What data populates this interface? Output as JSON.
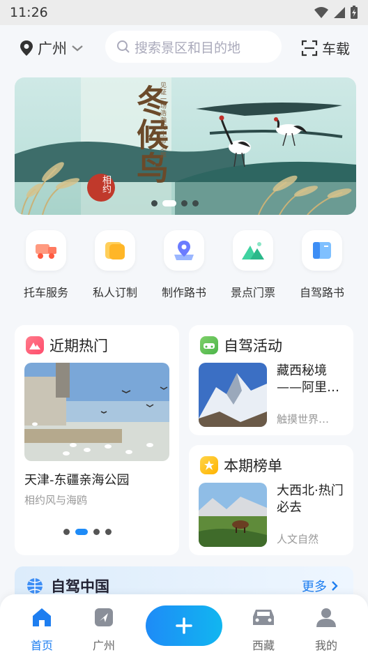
{
  "status_bar": {
    "time": "11:26"
  },
  "header": {
    "city": "广州",
    "search_placeholder": "搜索景区和目的地",
    "carload_label": "车载"
  },
  "banner": {
    "title": "冬候鸟",
    "subtitle_vertical": "见证一场浩瀚的生命之旅",
    "seal_text": "相约",
    "page_count": 4,
    "active_page": 1
  },
  "quick_nav": [
    {
      "label": "托车服务",
      "icon": "truck-icon"
    },
    {
      "label": "私人订制",
      "icon": "folder-icon"
    },
    {
      "label": "制作路书",
      "icon": "map-pin-icon"
    },
    {
      "label": "景点门票",
      "icon": "mountain-icon"
    },
    {
      "label": "自驾路书",
      "icon": "book-icon"
    }
  ],
  "hot_card": {
    "title": "近期热门",
    "item_name": "天津-东疆亲海公园",
    "item_sub": "相约风与海鸥",
    "page_count": 4,
    "active_page": 2
  },
  "activity_card": {
    "title": "自驾活动",
    "item_title": "藏西秘境——阿里…",
    "item_sub": "触摸世界…"
  },
  "ranking_card": {
    "title": "本期榜单",
    "item_title": "大西北·热门必去",
    "item_sub": "人文自然"
  },
  "self_drive_china": {
    "title": "自驾中国",
    "more_label": "更多"
  },
  "bottom_nav": [
    {
      "label": "首页",
      "icon": "home-icon",
      "active": true
    },
    {
      "label": "广州",
      "icon": "location-arrow-icon",
      "active": false
    },
    {
      "label": "",
      "icon": "plus-icon",
      "active": false
    },
    {
      "label": "西藏",
      "icon": "car-icon",
      "active": false
    },
    {
      "label": "我的",
      "icon": "user-icon",
      "active": false
    }
  ],
  "colors": {
    "accent": "#1e7ef0",
    "background": "#f5f7fa"
  }
}
